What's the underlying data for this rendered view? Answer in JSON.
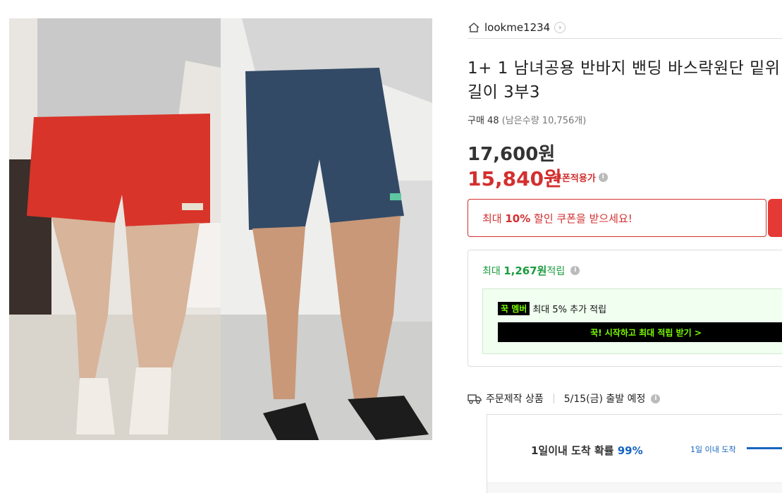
{
  "store": {
    "name": "lookme1234"
  },
  "product": {
    "title": "1+ 1 남녀공용 반바지 밴딩 바스락원단 밑위길이 3부3",
    "purchase_label": "구매 48",
    "stock_label": "(남은수량 10,756개)",
    "original_price": "17,600원",
    "sale_price": "15,840원",
    "coupon_applicable": "쿠폰적용가"
  },
  "coupon": {
    "prefix": "최대 ",
    "percent": "10%",
    "suffix": " 할인 쿠폰을 받으세요!"
  },
  "reward": {
    "prefix": "최대 ",
    "amount": "1,267원",
    "suffix": " 적립",
    "member_badge": "꾹 멤버",
    "member_text": "최대 5% 추가 적립",
    "member_cta": "꾹! 시작하고 최대 적립 받기 >"
  },
  "shipping": {
    "type": "주문제작 상품",
    "date": "5/15(금) 출발 예정",
    "arrive_prefix": "1일이내 도착 확률 ",
    "arrive_pct": "99%",
    "arrive_label": "1일 이내 도착"
  },
  "colors": {
    "accent": "#d32f2f",
    "green": "#1a9c3e",
    "blue": "#1565c0"
  },
  "icons": [
    "home-icon",
    "chevron-right-icon",
    "info-icon",
    "truck-icon"
  ]
}
